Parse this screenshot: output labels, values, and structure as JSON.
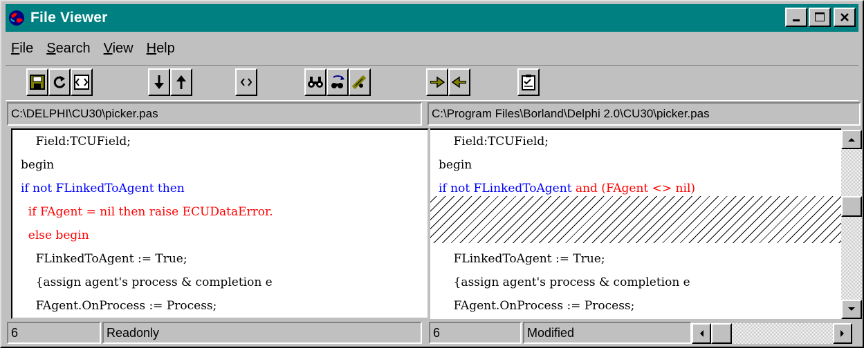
{
  "window": {
    "title": "File Viewer",
    "icon": "app-globe-icon",
    "buttons": [
      "minimize-icon",
      "maximize-icon",
      "close-icon"
    ]
  },
  "menu": [
    {
      "label": "File",
      "u": "F",
      "rest": "ile"
    },
    {
      "label": "Search",
      "u": "S",
      "rest": "earch"
    },
    {
      "label": "View",
      "u": "V",
      "rest": "iew"
    },
    {
      "label": "Help",
      "u": "H",
      "rest": "elp"
    }
  ],
  "toolbar": {
    "buttons": [
      "save-icon",
      "reload-icon",
      "compare-icon",
      "next-difference-icon",
      "previous-difference-icon",
      "matching-brace-icon",
      "find-icon",
      "find-again-icon",
      "replace-icon",
      "copy-right-icon",
      "copy-left-icon",
      "options-icon"
    ]
  },
  "left": {
    "path": "C:\\DELPHI\\CU30\\picker.pas",
    "status_line": "6",
    "status_mode": "Readonly",
    "lines": [
      [
        {
          "t": "    Field:TCUField;",
          "c": "black"
        }
      ],
      [
        {
          "t": "begin",
          "c": "black"
        }
      ],
      [
        {
          "t": "if not FLinkedToAgent then",
          "c": "blue"
        }
      ],
      [
        {
          "t": "  if FAgent = nil then raise ECUDataError.",
          "c": "red"
        }
      ],
      [
        {
          "t": "  else begin",
          "c": "red"
        }
      ],
      [
        {
          "t": "    FLinkedToAgent := True;",
          "c": "black"
        }
      ],
      [
        {
          "t": "    {assign agent's process & completion e",
          "c": "black"
        }
      ],
      [
        {
          "t": "    FAgent.OnProcess := Process;",
          "c": "black"
        }
      ]
    ]
  },
  "right": {
    "path": "C:\\Program Files\\Borland\\Delphi 2.0\\CU30\\picker.pas",
    "status_line": "6",
    "status_mode": "Modified",
    "lines": [
      [
        {
          "t": "    Field:TCUField;",
          "c": "black"
        }
      ],
      [
        {
          "t": "begin",
          "c": "black"
        }
      ],
      [
        {
          "t": "if not FLinkedToAgent ",
          "c": "blue"
        },
        {
          "t": "and (FAgent <> nil)",
          "c": "red"
        }
      ],
      [],
      [],
      [
        {
          "t": "    FLinkedToAgent := True;",
          "c": "black"
        }
      ],
      [
        {
          "t": "    {assign agent's process & completion e",
          "c": "black"
        }
      ],
      [
        {
          "t": "    FAgent.OnProcess := Process;",
          "c": "black"
        }
      ]
    ]
  },
  "colors": {
    "title_bar": "#008080",
    "inserted_text": "#0000ff",
    "changed_text": "#ff0000"
  }
}
